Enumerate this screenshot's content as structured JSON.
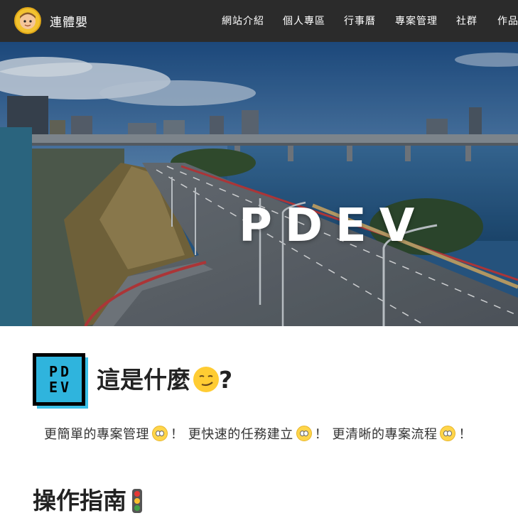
{
  "header": {
    "brand_name": "連體嬰",
    "nav": [
      {
        "label": "網站介紹"
      },
      {
        "label": "個人專區"
      },
      {
        "label": "行事曆"
      },
      {
        "label": "專案管理"
      },
      {
        "label": "社群"
      },
      {
        "label": "作品"
      }
    ]
  },
  "hero": {
    "title": "PDEV"
  },
  "what_section": {
    "logo_line1": "PD",
    "logo_line2": "EV",
    "heading": "這是什麼",
    "heading_suffix": "?",
    "heading_emoji": "smirking-face-icon"
  },
  "tagline": {
    "parts": [
      "更簡單的專案管理",
      "！ 更快速的任務建立",
      "！ 更清晰的專案流程",
      "！"
    ],
    "emoji": "flushed-face-icon"
  },
  "guide": {
    "heading": "操作指南",
    "emoji": "traffic-light-icon"
  },
  "colors": {
    "navbar": "#2b2b2b",
    "logo_accent": "#2fb4dd",
    "avatar": "#f2c230"
  }
}
